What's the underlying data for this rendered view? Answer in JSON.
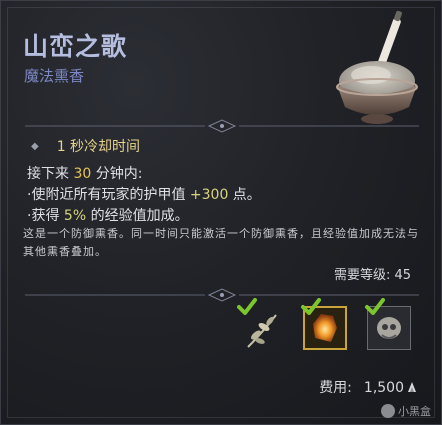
{
  "item": {
    "name": "山峦之歌",
    "type": "魔法熏香"
  },
  "cooldown": "1 秒冷却时间",
  "effects": {
    "intro_prefix": "接下来 ",
    "duration_value": "30",
    "intro_suffix": " 分钟内:",
    "line1_prefix": "·使附近所有玩家的护甲值 ",
    "armor_value": "+300",
    "line1_suffix": " 点。",
    "line2_prefix": "·获得 ",
    "xp_value": "5%",
    "line2_suffix": " 的经验值加成。"
  },
  "flavor_text": "这是一个防御熏香。同一时间只能激活一个防御熏香，且经验值加成无法与其他熏香叠加。",
  "requirement": {
    "label": "需要等级: ",
    "value": "45"
  },
  "ingredients": [
    {
      "icon": "herb-sprig-icon",
      "fulfilled": true
    },
    {
      "icon": "flame-crystal-icon",
      "fulfilled": true
    },
    {
      "icon": "skull-ore-icon",
      "fulfilled": true
    }
  ],
  "cost": {
    "label": "费用:",
    "value": "1,500",
    "icon": "coin-icon"
  },
  "watermark": "小黑盒",
  "colors": {
    "title": "#b5bedf",
    "subtitle": "#7d88c4",
    "cooldown": "#e6d28a",
    "highlight": "#e7c25a",
    "check": "#7cc62d",
    "selected_border": "#c9a43a"
  }
}
